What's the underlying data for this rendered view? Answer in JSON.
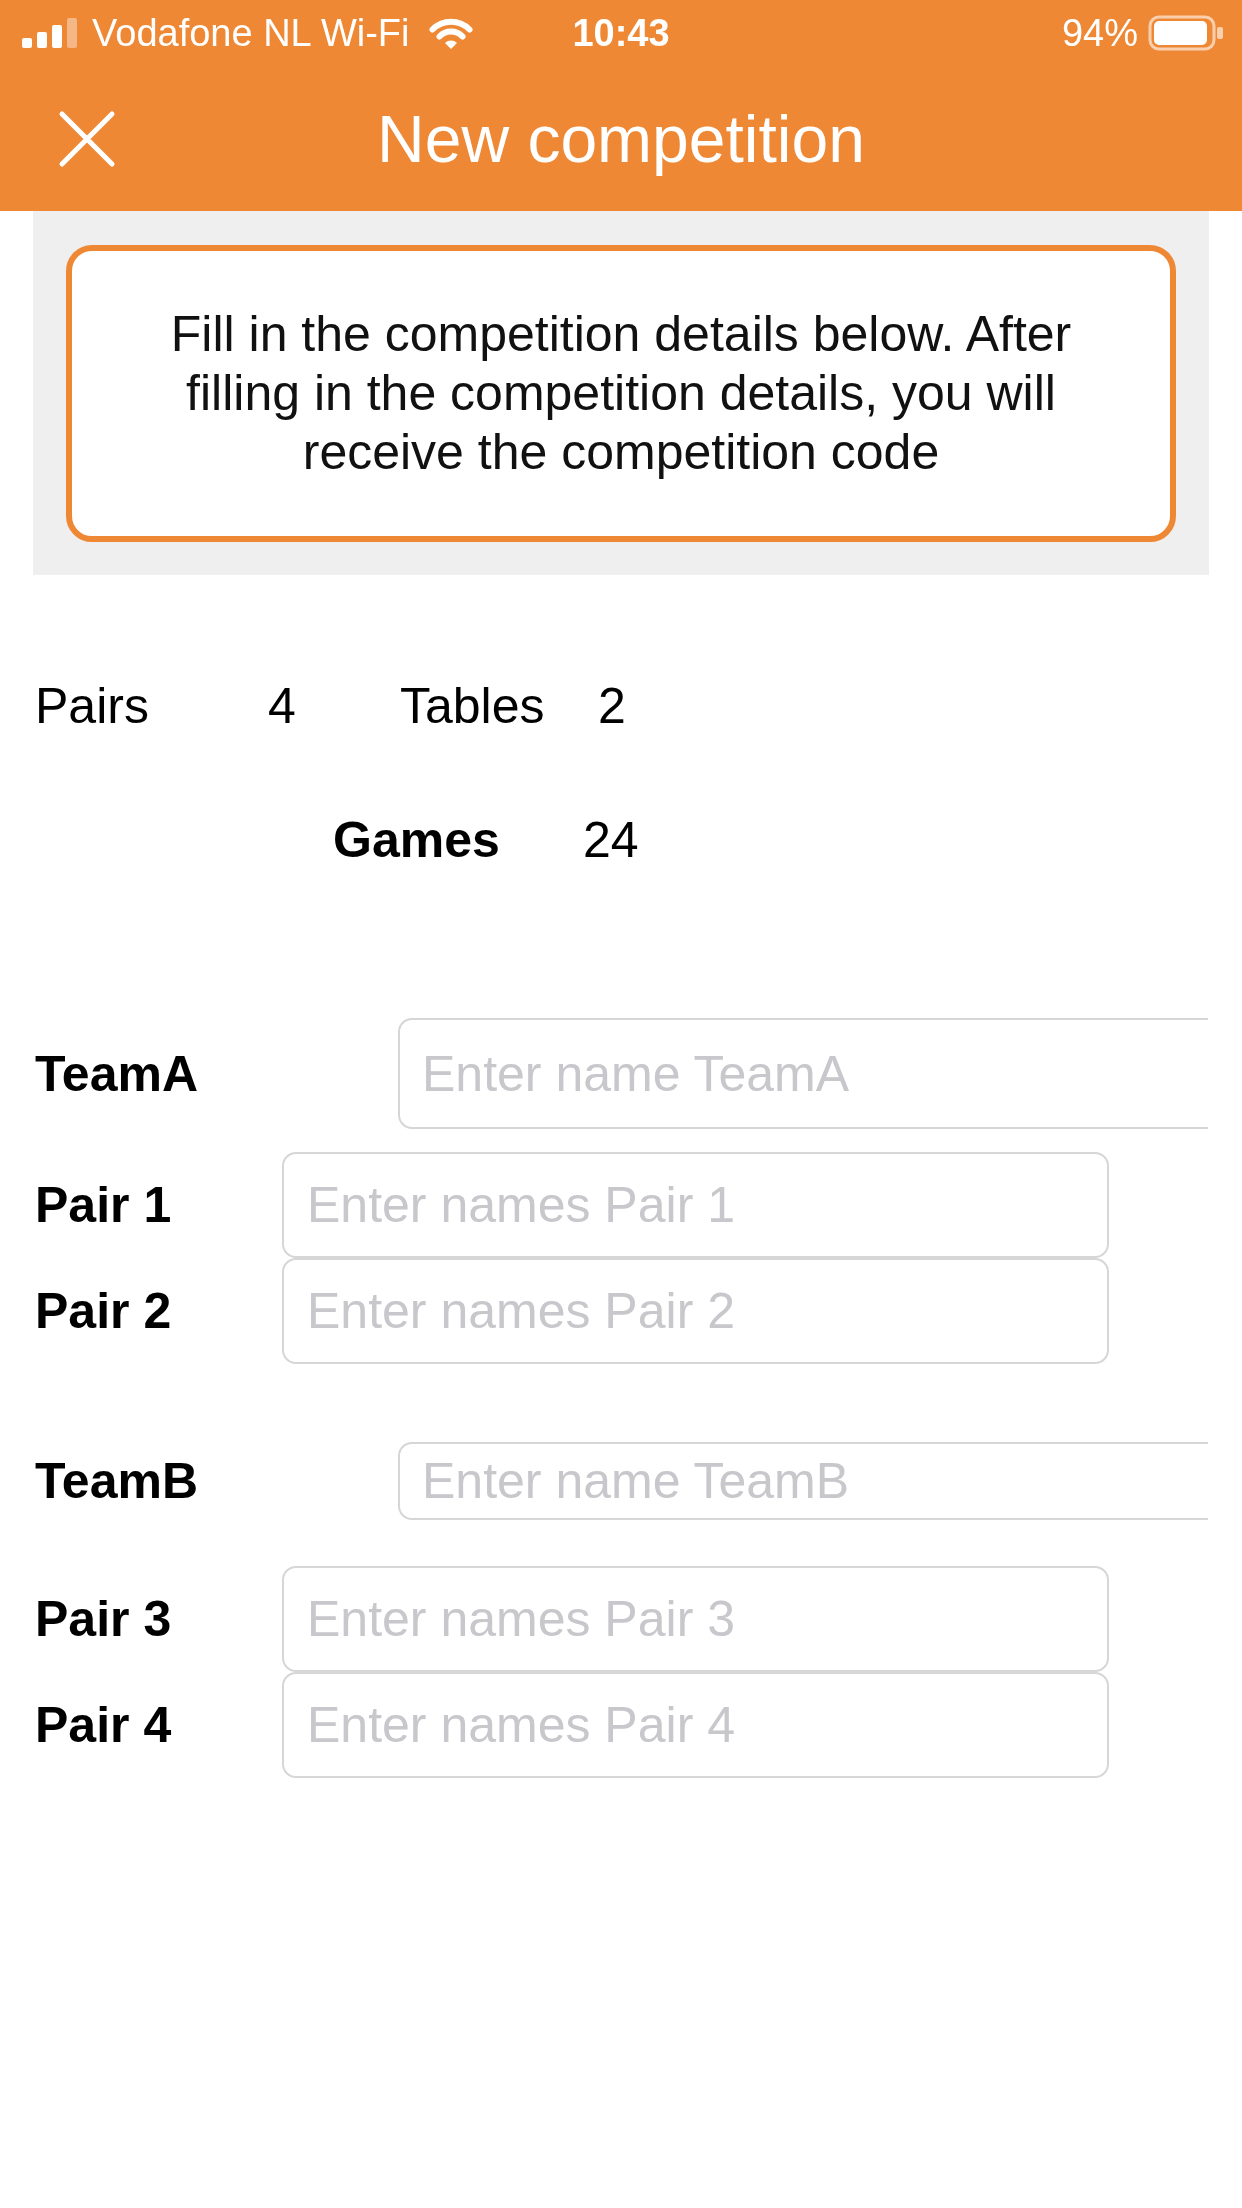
{
  "status_bar": {
    "carrier": "Vodafone NL Wi-Fi",
    "time": "10:43",
    "battery": "94%"
  },
  "header": {
    "title": "New competition"
  },
  "info": {
    "text": "Fill in the competition details below. After filling in the competition details, you will receive the competition code"
  },
  "stats": [
    {
      "label": "Pairs",
      "value": "4"
    },
    {
      "label": "Tables",
      "value": "2"
    }
  ],
  "total": {
    "label": "Games",
    "value": "24"
  },
  "teams": [
    {
      "label": "TeamA",
      "placeholder": "Enter name TeamA",
      "pairs": [
        {
          "label": "Pair 1",
          "placeholder": "Enter names Pair 1"
        },
        {
          "label": "Pair 2",
          "placeholder": "Enter names Pair 2"
        }
      ]
    },
    {
      "label": "TeamB",
      "placeholder": "Enter name TeamB",
      "pairs": [
        {
          "label": "Pair 3",
          "placeholder": "Enter names Pair 3"
        },
        {
          "label": "Pair 4",
          "placeholder": "Enter names Pair 4"
        }
      ]
    }
  ]
}
